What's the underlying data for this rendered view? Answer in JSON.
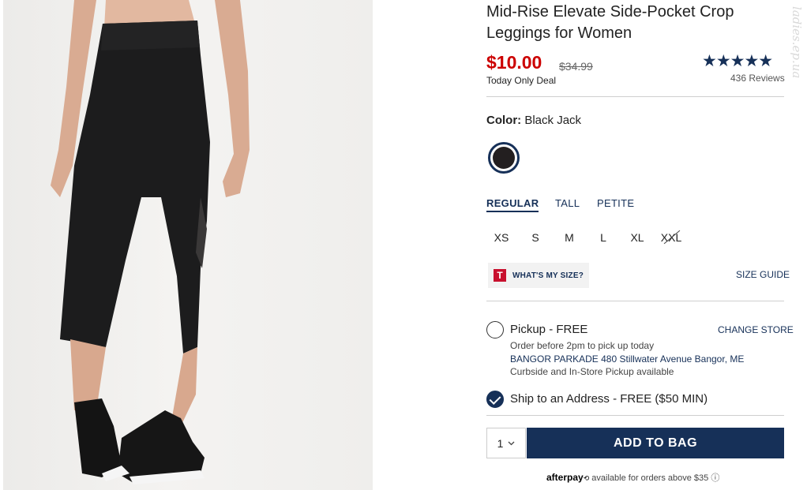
{
  "product": {
    "title": "Mid-Rise Elevate Side-Pocket Crop Leggings for Women",
    "price": "$10.00",
    "original_price": "$34.99",
    "deal_text": "Today Only Deal",
    "rating_stars": "★★★★★",
    "rating": 4.5,
    "reviews": "436 Reviews"
  },
  "color": {
    "label": "Color:",
    "value": "Black Jack",
    "swatch_color": "#231f20"
  },
  "fit_tabs": [
    "REGULAR",
    "TALL",
    "PETITE"
  ],
  "sizes": [
    "XS",
    "S",
    "M",
    "L",
    "XL",
    "XXL"
  ],
  "whats_my_size": {
    "icon_letter": "T",
    "label": "WHAT'S MY SIZE?"
  },
  "size_guide": "SIZE GUIDE",
  "pickup": {
    "label": "Pickup - FREE",
    "change_store": "CHANGE STORE",
    "order_note": "Order before 2pm to pick up today",
    "store": "BANGOR PARKADE 480 Stillwater Avenue  Bangor, ME",
    "availability": "Curbside and In-Store Pickup available"
  },
  "ship": {
    "label": "Ship to an Address - FREE ($50 MIN)"
  },
  "quantity": "1",
  "add_to_bag": "ADD TO BAG",
  "afterpay": {
    "brand": "afterpay",
    "text": "available for orders above $35",
    "info_icon": "ⓘ"
  },
  "watermark": "ladies.ep.ua",
  "colors": {
    "navy": "#163058",
    "sale_red": "#cc0000"
  }
}
